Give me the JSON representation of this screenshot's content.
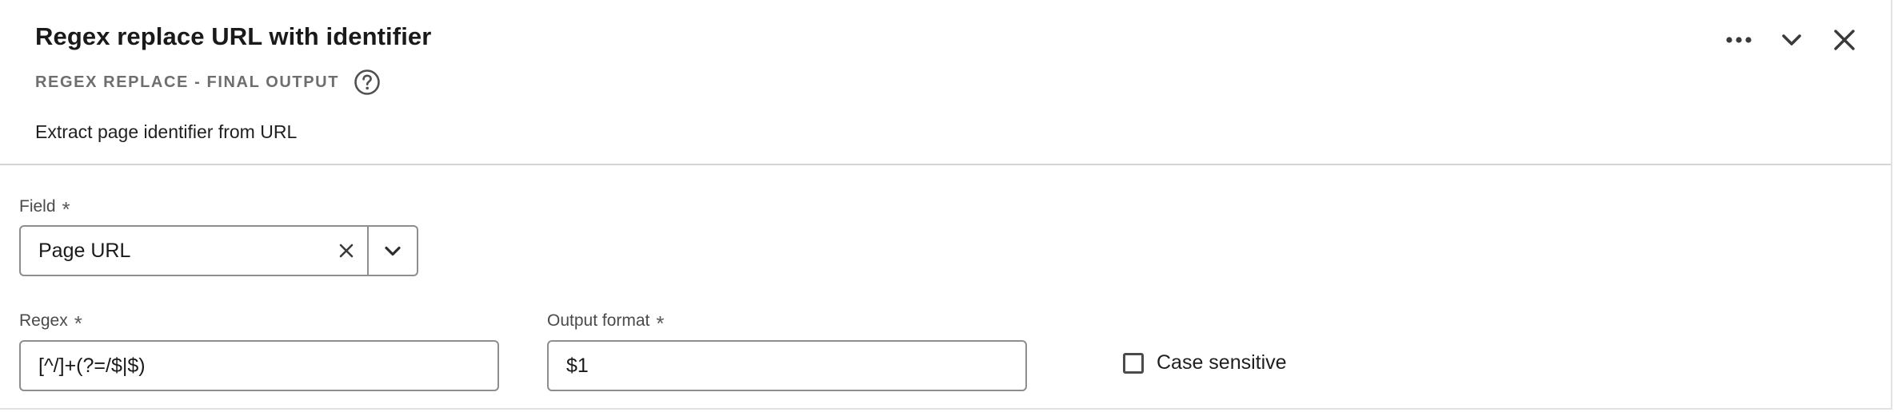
{
  "header": {
    "title": "Regex replace URL with identifier",
    "subtitle": "REGEX REPLACE - FINAL OUTPUT",
    "description": "Extract page identifier from URL",
    "icons": [
      "more-icon",
      "chevron-down-icon",
      "close-icon",
      "help-icon"
    ]
  },
  "form": {
    "field": {
      "label": "Field",
      "required_marker": "*",
      "value": "Page URL"
    },
    "regex": {
      "label": "Regex",
      "required_marker": "*",
      "value": "[^/]+(?=/$|$)"
    },
    "output_format": {
      "label": "Output format",
      "required_marker": "*",
      "value": "$1"
    },
    "case_sensitive": {
      "label": "Case sensitive",
      "checked": false
    }
  }
}
